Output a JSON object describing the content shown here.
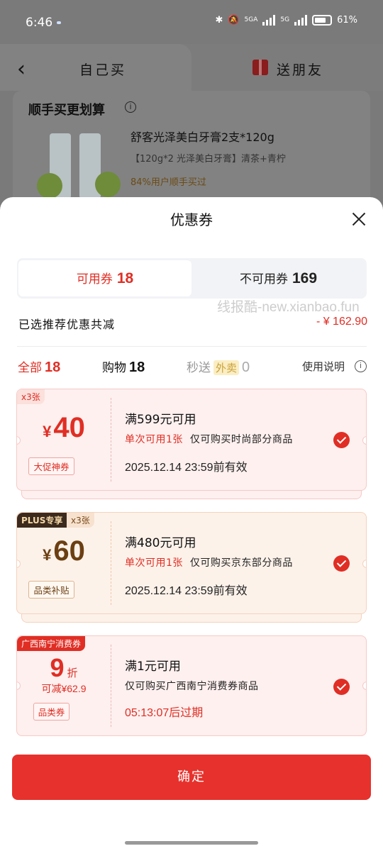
{
  "status": {
    "time": "6:46",
    "network_a": "5GA",
    "network_b": "5G",
    "battery": "61%"
  },
  "background": {
    "tab_own": "自己买",
    "tab_gift": "送朋友",
    "section_title": "顺手买更划算",
    "product_name": "舒客光泽美白牙膏2支*120g",
    "product_spec": "【120g*2 光泽美白牙膏】清茶+青柠",
    "product_tip": "84%用户顺手买过"
  },
  "sheet": {
    "title": "优惠券",
    "seg_available_label": "可用券",
    "seg_available_count": "18",
    "seg_unavailable_label": "不可用券",
    "seg_unavailable_count": "169",
    "watermark": "线报酷-new.xianbao.fun",
    "saved_label": "已选推荐优惠共减",
    "saved_amount": "- ¥ 162.90",
    "filters": {
      "all_label": "全部",
      "all_count": "18",
      "shop_label": "购物",
      "shop_count": "18",
      "express_label": "秒送",
      "takeout_label": "外卖",
      "express_count": "0",
      "help_label": "使用说明"
    },
    "coupons": [
      {
        "tag": "x3张",
        "currency": "¥",
        "amount": "40",
        "badge": "大促神券",
        "title": "满599元可用",
        "limit": "单次可用1张",
        "scope": "仅可购买时尚部分商品",
        "validity": "2025.12.14 23:59前有效"
      },
      {
        "plus_tag": "PLUS专享",
        "tag": "x3张",
        "currency": "¥",
        "amount": "60",
        "badge": "品类补贴",
        "title": "满480元可用",
        "limit": "单次可用1张",
        "scope": "仅可购买京东部分商品",
        "validity": "2025.12.14 23:59前有效"
      },
      {
        "tag": "广西南宁消费券",
        "amount": "9",
        "unit": "折",
        "max_off": "可减¥62.9",
        "badge": "品类券",
        "title": "满1元可用",
        "scope": "仅可购买广西南宁消费券商品",
        "countdown": "05:13:07后过期"
      }
    ],
    "confirm_label": "确定"
  },
  "colors": {
    "accent": "#e02e24",
    "confirm": "#e7312c",
    "plus": "#3b2a1d",
    "gold": "#6b3f12"
  }
}
